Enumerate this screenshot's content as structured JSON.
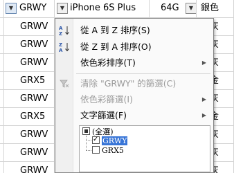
{
  "header": {
    "col_a": "GRWY",
    "col_b": "iPhone 6S Plus",
    "col_c": "64G",
    "col_d": "銀色"
  },
  "rows": [
    {
      "col_a": "GRWV",
      "col_d": "空灰"
    },
    {
      "col_a": "GRWV",
      "col_d": "空灰"
    },
    {
      "col_a": "GRWV",
      "col_d": "空灰"
    },
    {
      "col_a": "GRX5",
      "col_d": "瑰金"
    },
    {
      "col_a": "GRWV",
      "col_d": "空灰"
    },
    {
      "col_a": "GRX5",
      "col_d": "瑰金"
    },
    {
      "col_a": "GRWV",
      "col_d": "空灰"
    },
    {
      "col_a": "GRWV",
      "col_d": "空灰"
    },
    {
      "col_a": "GRWV",
      "col_d": "空灰"
    }
  ],
  "menu": {
    "sort_asc": "從 A 到 Z 排序(S)",
    "sort_desc": "從 Z 到 A 排序(O)",
    "sort_by_color": "依色彩排序(T)",
    "clear_filter": "清除 \"GRWY\" 的篩選(C)",
    "filter_by_color": "依色彩篩選(I)",
    "text_filter": "文字篩選(F)"
  },
  "filter_list": [
    {
      "label": "(全選)",
      "state": "partial"
    },
    {
      "label": "GRWY",
      "state": "checked"
    },
    {
      "label": "GRX5",
      "state": "unchecked"
    }
  ]
}
